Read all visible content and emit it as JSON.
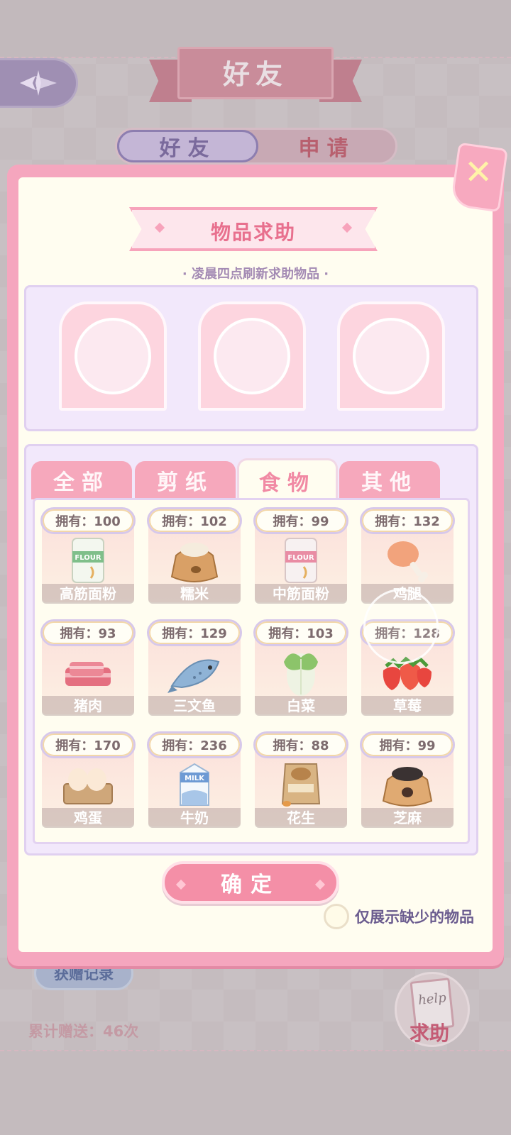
{
  "background": {
    "title": "好友",
    "tabs": [
      {
        "label": "好友",
        "active": true
      },
      {
        "label": "申请",
        "active": false
      }
    ],
    "gift_record_label": "获赠记录",
    "gift_total": "累计赠送：46次",
    "help_button_label": "求助",
    "help_script": "help"
  },
  "dialog": {
    "title": "物品求助",
    "subtitle": "· 凌晨四点刷新求助物品 ·",
    "close_icon": "close-icon",
    "slots": 3,
    "category_tabs": [
      {
        "label": "全部",
        "active": false
      },
      {
        "label": "剪纸",
        "active": false
      },
      {
        "label": "食物",
        "active": true
      },
      {
        "label": "其他",
        "active": false
      }
    ],
    "items": [
      {
        "name": "高筋面粉",
        "owned": "拥有：100",
        "icon": "flour-bag-green"
      },
      {
        "name": "糯米",
        "owned": "拥有：102",
        "icon": "rice-sack"
      },
      {
        "name": "中筋面粉",
        "owned": "拥有：99",
        "icon": "flour-bag-pink"
      },
      {
        "name": "鸡腿",
        "owned": "拥有：132",
        "icon": "chicken-leg"
      },
      {
        "name": "猪肉",
        "owned": "拥有：93",
        "icon": "pork"
      },
      {
        "name": "三文鱼",
        "owned": "拥有：129",
        "icon": "salmon"
      },
      {
        "name": "白菜",
        "owned": "拥有：103",
        "icon": "cabbage"
      },
      {
        "name": "草莓",
        "owned": "拥有：128",
        "icon": "strawberry"
      },
      {
        "name": "鸡蛋",
        "owned": "拥有：170",
        "icon": "eggs"
      },
      {
        "name": "牛奶",
        "owned": "拥有：236",
        "icon": "milk-carton"
      },
      {
        "name": "花生",
        "owned": "拥有：88",
        "icon": "peanut-bag"
      },
      {
        "name": "芝麻",
        "owned": "拥有：99",
        "icon": "sesame-sack"
      }
    ],
    "confirm_label": "确定",
    "filter_label": "仅展示缺少的物品",
    "filter_checked": false
  },
  "colors": {
    "accent_pink": "#f48fa7",
    "panel_lavender": "#f2e8fb",
    "cream": "#fffdf0"
  }
}
